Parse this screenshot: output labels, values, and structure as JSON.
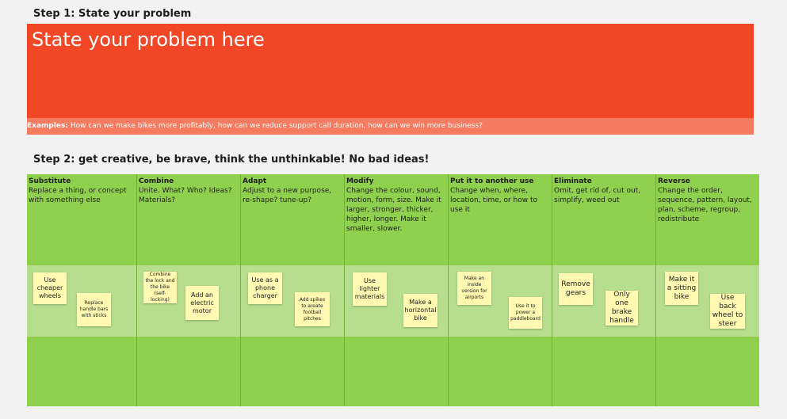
{
  "step1": {
    "title": "Step 1: State your problem",
    "problem_placeholder": "State your problem here",
    "examples_label": "Examples:",
    "examples_text": " How can we make bikes more profitably, how can we reduce support call duration, how can we win more business?"
  },
  "step2": {
    "title": "Step 2: get creative, be brave, think the unthinkable! No bad ideas!"
  },
  "columns": [
    {
      "title": "Substitute",
      "desc": "Replace a thing, or concept with something else",
      "notes": [
        "Use cheaper wheels",
        "Replace handle bars with sticks"
      ]
    },
    {
      "title": "Combine",
      "desc": "Unite. What? Who? Ideas? Materials?",
      "notes": [
        "Combine the lock and the bike (self-locking)",
        "Add an electric motor"
      ]
    },
    {
      "title": "Adapt",
      "desc": "Adjust to a new purpose, re-shape? tune-up?",
      "notes": [
        "Use as a phone charger",
        "Add spikes to areate football pitches"
      ]
    },
    {
      "title": "Modify",
      "desc": "Change the colour, sound, motion, form, size. Make it larger, stronger, thicker, higher, longer. Make it smaller, slower.",
      "notes": [
        "Use lighter materials",
        "Make a horizontal bike"
      ]
    },
    {
      "title": "Put it to another use",
      "desc": "Change when, where, location, time, or how to use it",
      "notes": [
        "Make an inside version for airports",
        "Use it to power a paddleboard"
      ]
    },
    {
      "title": "Eliminate",
      "desc": "Omit, get rid of, cut out, simplify, weed out",
      "notes": [
        "Remove gears",
        "Only one brake handle"
      ]
    },
    {
      "title": "Reverse",
      "desc": "Change the order, sequence, pattern, layout, plan, scheme, regroup, redistribute",
      "notes": [
        "Make it a sitting bike",
        "Use back wheel to steer"
      ]
    }
  ],
  "colors": {
    "problem_bg": "#f24726",
    "examples_bg": "#f47a60",
    "board_bg": "#8fd14f",
    "band_bg": "#b7dd8f",
    "sticky_bg": "#fff9b1"
  }
}
